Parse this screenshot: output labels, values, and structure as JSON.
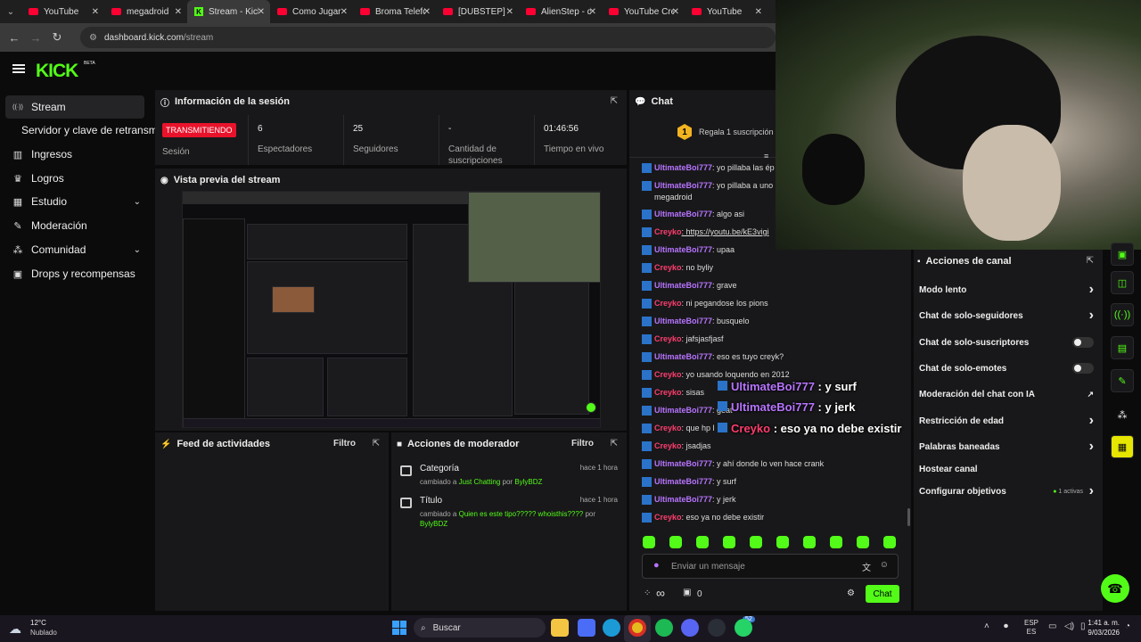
{
  "browser": {
    "tabs": [
      {
        "label": "YouTube",
        "favicon": "youtube-icon"
      },
      {
        "label": "megadroid",
        "favicon": "youtube-icon"
      },
      {
        "label": "Stream - Kick",
        "favicon": "kick-icon",
        "active": true
      },
      {
        "label": "Como Jugar",
        "favicon": "youtube-icon"
      },
      {
        "label": "Broma Telefónica",
        "favicon": "youtube-icon"
      },
      {
        "label": "[DUBSTEP] T",
        "favicon": "youtube-icon"
      },
      {
        "label": "AlienStep - d",
        "favicon": "youtube-icon"
      },
      {
        "label": "YouTube Cre",
        "favicon": "youtube-icon"
      },
      {
        "label": "YouTube",
        "favicon": "youtube-icon"
      }
    ],
    "url_domain": "dashboard.kick.com",
    "url_path": "/stream"
  },
  "header": {
    "logo": "KICK",
    "logo_badge": "BETA"
  },
  "sidebar": {
    "items": [
      {
        "label": "Stream",
        "icon": "broadcast-icon"
      },
      {
        "label": "Servidor y clave de retransmi",
        "icon": ""
      },
      {
        "label": "Ingresos",
        "icon": "chart-icon"
      },
      {
        "label": "Logros",
        "icon": "trophy-icon"
      },
      {
        "label": "Estudio",
        "icon": "studio-icon"
      },
      {
        "label": "Moderación",
        "icon": "wrench-icon"
      },
      {
        "label": "Comunidad",
        "icon": "people-icon"
      },
      {
        "label": "Drops y recompensas",
        "icon": "gift-icon"
      }
    ]
  },
  "session": {
    "title": "Información de la sesión",
    "badge": "TRANSMITIENDO",
    "badge_label": "Sesión",
    "stats": [
      {
        "value": "6",
        "label": "Espectadores"
      },
      {
        "value": "25",
        "label": "Seguidores"
      },
      {
        "value": "-",
        "label": "Cantidad de suscripciones"
      },
      {
        "value": "01:46:56",
        "label": "Tiempo en vivo"
      }
    ]
  },
  "preview": {
    "title": "Vista previa del stream"
  },
  "activity": {
    "title": "Feed de actividades",
    "filter": "Filtro"
  },
  "modactions": {
    "title": "Acciones de moderador",
    "filter": "Filtro",
    "rows": [
      {
        "title": "Categoría",
        "prefix": "cambiado a ",
        "value": "Just Chatting",
        "by": " por ",
        "user": "BylyBDZ",
        "time": "hace 1 hora"
      },
      {
        "title": "Título",
        "prefix": "cambiado a ",
        "value": "Quien es este tipo????? whoisthis????",
        "by": " por ",
        "user": "BylyBDZ",
        "time": "hace 1 hora"
      }
    ]
  },
  "chat": {
    "title": "Chat",
    "pinned_badge": "1",
    "pinned_text": "Regala 1 suscripción",
    "messages": [
      {
        "user": "UltimateBoi777",
        "type": "u1",
        "text": ": yo pillaba las ép"
      },
      {
        "user": "UltimateBoi777",
        "type": "u1",
        "text": ": yo pillaba a uno megadroid"
      },
      {
        "user": "UltimateBoi777",
        "type": "u1",
        "text": ": algo asi"
      },
      {
        "user": "Creyko",
        "type": "u2",
        "text": ": https://youtu.be/kE3vigi"
      },
      {
        "user": "UltimateBoi777",
        "type": "u1",
        "text": ": upaa"
      },
      {
        "user": "Creyko",
        "type": "u2",
        "text": ": no byliy"
      },
      {
        "user": "UltimateBoi777",
        "type": "u1",
        "text": ": grave"
      },
      {
        "user": "Creyko",
        "type": "u2",
        "text": ": ni pegandose los pions"
      },
      {
        "user": "UltimateBoi777",
        "type": "u1",
        "text": ": busquelo"
      },
      {
        "user": "Creyko",
        "type": "u2",
        "text": ": jafsjasfjasf"
      },
      {
        "user": "UltimateBoi777",
        "type": "u1",
        "text": ": eso es tuyo creyk?"
      },
      {
        "user": "Creyko",
        "type": "u2",
        "text": ": yo usando loquendo en 2012"
      },
      {
        "user": "Creyko",
        "type": "u2",
        "text": ": sisas"
      },
      {
        "user": "UltimateBoi777",
        "type": "u1",
        "text": ": geat"
      },
      {
        "user": "Creyko",
        "type": "u2",
        "text": ": que hp l"
      },
      {
        "user": "Creyko",
        "type": "u2",
        "text": ": jsadjas"
      },
      {
        "user": "UltimateBoi777",
        "type": "u1",
        "text": ": y ahí donde lo ven hace crank"
      },
      {
        "user": "UltimateBoi777",
        "type": "u1",
        "text": ": y surf"
      },
      {
        "user": "UltimateBoi777",
        "type": "u1",
        "text": ": y jerk"
      },
      {
        "user": "Creyko",
        "type": "u2",
        "text": ": eso ya no debe existir"
      }
    ],
    "overlay": [
      {
        "user": "UltimateBoi777",
        "type": "u1",
        "text": " : y surf"
      },
      {
        "user": "UltimateBoi777",
        "type": "u1",
        "text": " : y jerk"
      },
      {
        "user": "Creyko",
        "type": "u2",
        "text": " : eso ya no debe existir"
      }
    ],
    "input_placeholder": "Enviar un mensaje",
    "send_label": "Chat",
    "footer_infinity": "∞",
    "footer_count": "0"
  },
  "channel_actions": {
    "title": "Acciones de canal",
    "items": [
      {
        "label": "Modo lento",
        "control": "chevron"
      },
      {
        "label": "Chat de solo-seguidores",
        "control": "chevron"
      },
      {
        "label": "Chat de solo-suscriptores",
        "control": "toggle"
      },
      {
        "label": "Chat de solo-emotes",
        "control": "toggle"
      },
      {
        "label": "Moderación del chat con IA",
        "control": "external"
      },
      {
        "label": "Restricción de edad",
        "control": "chevron"
      },
      {
        "label": "Palabras baneadas",
        "control": "chevron"
      },
      {
        "label": "Hostear canal",
        "control": "none"
      },
      {
        "label": "Configurar objetivos",
        "control": "chevron",
        "status": "1 activas"
      }
    ]
  },
  "taskbar": {
    "weather_temp": "12°C",
    "weather_desc": "Nublado",
    "search_placeholder": "Buscar",
    "lang": "ESP",
    "lang2": "ES",
    "time": "1:41 a. m.",
    "date": "9/03/2026",
    "notif_count": "52"
  },
  "colors": {
    "kick_green": "#53fc18",
    "live_red": "#e8132b",
    "user_purple": "#b774ff",
    "user_red": "#ff3d6e"
  }
}
